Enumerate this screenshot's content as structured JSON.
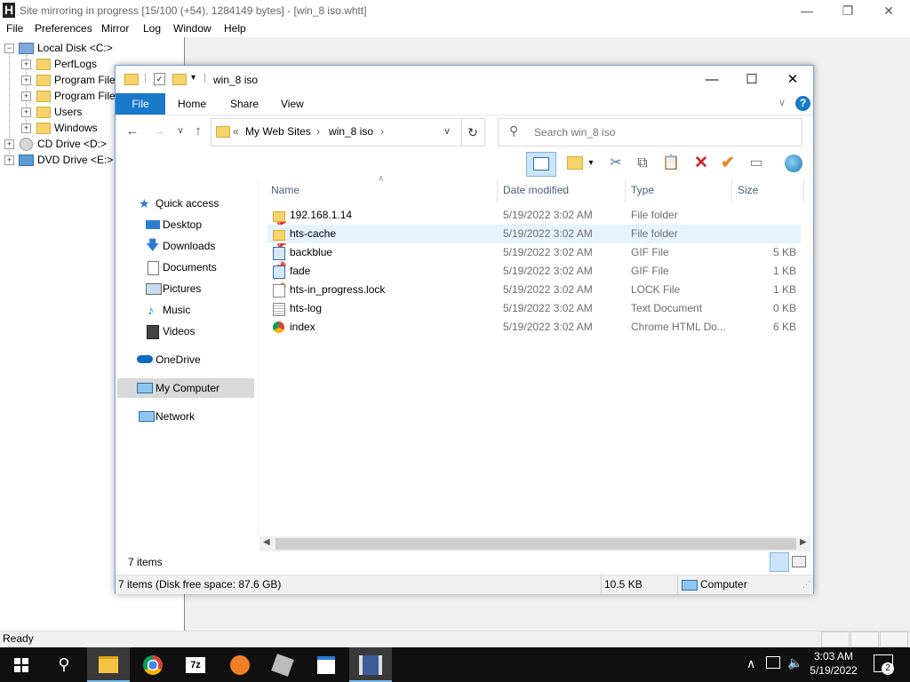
{
  "httrack": {
    "title": "Site mirroring in progress [15/100 (+54), 1284149 bytes] - [win_8 iso.whtt]",
    "menus": [
      "File",
      "Preferences",
      "Mirror",
      "Log",
      "Window",
      "Help"
    ],
    "tree": {
      "root": "Local Disk <C:>",
      "children": [
        "PerfLogs",
        "Program File",
        "Program File",
        "Users",
        "Windows"
      ],
      "drives": [
        "CD Drive <D:>",
        "DVD Drive <E:>"
      ]
    },
    "status": "Ready"
  },
  "explorer": {
    "title": "win_8 iso",
    "ribbon_tabs": [
      "File",
      "Home",
      "Share",
      "View"
    ],
    "help_label": "?",
    "address": {
      "prefix": "«",
      "crumbs": [
        "My Web Sites",
        "win_8 iso"
      ]
    },
    "search_placeholder": "Search win_8 iso",
    "nav": {
      "quick_access": "Quick access",
      "pinned": [
        "Desktop",
        "Downloads",
        "Documents",
        "Pictures"
      ],
      "others": [
        "Music",
        "Videos"
      ],
      "onedrive": "OneDrive",
      "computer": "My Computer",
      "network": "Network"
    },
    "columns": [
      "Name",
      "Date modified",
      "Type",
      "Size"
    ],
    "rows": [
      {
        "name": "192.168.1.14",
        "date": "5/19/2022 3:02 AM",
        "type": "File folder",
        "size": "",
        "icon": "folder-icon"
      },
      {
        "name": "hts-cache",
        "date": "5/19/2022 3:02 AM",
        "type": "File folder",
        "size": "",
        "icon": "folder-icon"
      },
      {
        "name": "backblue",
        "date": "5/19/2022 3:02 AM",
        "type": "GIF File",
        "size": "5 KB",
        "icon": "image-file-icon"
      },
      {
        "name": "fade",
        "date": "5/19/2022 3:02 AM",
        "type": "GIF File",
        "size": "1 KB",
        "icon": "image-file-icon"
      },
      {
        "name": "hts-in_progress.lock",
        "date": "5/19/2022 3:02 AM",
        "type": "LOCK File",
        "size": "1 KB",
        "icon": "file-icon"
      },
      {
        "name": "hts-log",
        "date": "5/19/2022 3:02 AM",
        "type": "Text Document",
        "size": "0 KB",
        "icon": "text-file-icon"
      },
      {
        "name": "index",
        "date": "5/19/2022 3:02 AM",
        "type": "Chrome HTML Do...",
        "size": "6 KB",
        "icon": "chrome-html-icon"
      }
    ],
    "selected_row": 1,
    "item_count": "7 items",
    "status_left": "7 items (Disk free space: 87.6 GB)",
    "status_size": "10.5 KB",
    "status_location": "Computer"
  },
  "taskbar": {
    "apps": [
      "file-explorer",
      "chrome",
      "7zip",
      "app-orange",
      "app-tool",
      "app-window",
      "httrack"
    ],
    "time": "3:03 AM",
    "date": "5/19/2022",
    "notification_count": "2"
  },
  "colors": {
    "accent": "#1979ca",
    "selection": "#e5f3ff",
    "taskbar": "#101010",
    "folder": "#f6d36b"
  }
}
